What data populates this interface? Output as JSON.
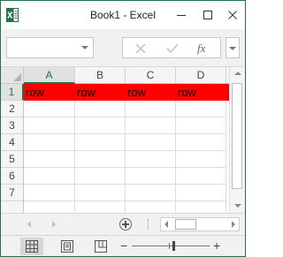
{
  "window": {
    "title": "Book1 - Excel",
    "accent_color": "#217346"
  },
  "formula_bar": {
    "name_box_value": "",
    "fx_label": "fx"
  },
  "sheet": {
    "columns": [
      "A",
      "B",
      "C",
      "D"
    ],
    "rows": [
      "1",
      "2",
      "3",
      "4",
      "5",
      "6",
      "7"
    ],
    "row1": [
      "row",
      "row",
      "row",
      "row"
    ],
    "fill_color": "#ff0000"
  },
  "status_bar": {
    "zoom_minus": "−",
    "zoom_plus": "+"
  }
}
